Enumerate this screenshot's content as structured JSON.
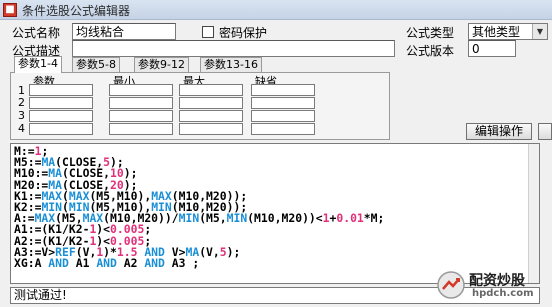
{
  "window": {
    "title": "条件选股公式编辑器"
  },
  "form": {
    "name_label": "公式名称",
    "name_value": "均线粘合",
    "password_label": "密码保护",
    "desc_label": "公式描述",
    "desc_value": "",
    "type_label": "公式类型",
    "type_value": "其他类型",
    "version_label": "公式版本",
    "version_value": "0"
  },
  "tabs": [
    "参数1-4",
    "参数5-8",
    "参数9-12",
    "参数13-16"
  ],
  "params": {
    "headers": [
      "参数",
      "最小",
      "最大",
      "缺省"
    ],
    "row_numbers": [
      "1",
      "2",
      "3",
      "4"
    ]
  },
  "buttons": {
    "edit_op": "编辑操作"
  },
  "code": [
    [
      [
        "M:=",
        "p"
      ],
      [
        "1",
        "n"
      ],
      [
        ";",
        "p"
      ]
    ],
    [
      [
        "M5:=",
        "p"
      ],
      [
        "MA",
        "f"
      ],
      [
        "(CLOSE,",
        "p"
      ],
      [
        "5",
        "n"
      ],
      [
        ");",
        "p"
      ]
    ],
    [
      [
        "M10:=",
        "p"
      ],
      [
        "MA",
        "f"
      ],
      [
        "(CLOSE,",
        "p"
      ],
      [
        "10",
        "n"
      ],
      [
        ");",
        "p"
      ]
    ],
    [
      [
        "M20:=",
        "p"
      ],
      [
        "MA",
        "f"
      ],
      [
        "(CLOSE,",
        "p"
      ],
      [
        "20",
        "n"
      ],
      [
        ");",
        "p"
      ]
    ],
    [
      [
        "K1:=",
        "p"
      ],
      [
        "MAX",
        "f"
      ],
      [
        "(",
        "p"
      ],
      [
        "MAX",
        "f"
      ],
      [
        "(M5,M10),",
        "p"
      ],
      [
        "MAX",
        "f"
      ],
      [
        "(M10,M20));",
        "p"
      ]
    ],
    [
      [
        "K2:=",
        "p"
      ],
      [
        "MIN",
        "f"
      ],
      [
        "(",
        "p"
      ],
      [
        "MIN",
        "f"
      ],
      [
        "(M5,M10),",
        "p"
      ],
      [
        "MIN",
        "f"
      ],
      [
        "(M10,M20));",
        "p"
      ]
    ],
    [
      [
        "A:=",
        "p"
      ],
      [
        "MAX",
        "f"
      ],
      [
        "(M5,",
        "p"
      ],
      [
        "MAX",
        "f"
      ],
      [
        "(M10,M20))/",
        "p"
      ],
      [
        "MIN",
        "f"
      ],
      [
        "(M5,",
        "p"
      ],
      [
        "MIN",
        "f"
      ],
      [
        "(M10,M20))<",
        "p"
      ],
      [
        "1",
        "n"
      ],
      [
        "+",
        "p"
      ],
      [
        "0.01",
        "n"
      ],
      [
        "*M;",
        "p"
      ]
    ],
    [
      [
        "A1:=(K1/K2-",
        "p"
      ],
      [
        "1",
        "n"
      ],
      [
        ")<",
        "p"
      ],
      [
        "0.005",
        "n"
      ],
      [
        ";",
        "p"
      ]
    ],
    [
      [
        "A2:=(K1/K2-",
        "p"
      ],
      [
        "1",
        "n"
      ],
      [
        ")<",
        "p"
      ],
      [
        "0.005",
        "n"
      ],
      [
        ";",
        "p"
      ]
    ],
    [
      [
        "A3:=V>",
        "p"
      ],
      [
        "REF",
        "f"
      ],
      [
        "(V,",
        "p"
      ],
      [
        "1",
        "n"
      ],
      [
        ")*",
        "p"
      ],
      [
        "1.5",
        "n"
      ],
      [
        " ",
        "p"
      ],
      [
        "AND",
        "f"
      ],
      [
        " V>",
        "p"
      ],
      [
        "MA",
        "f"
      ],
      [
        "(V,",
        "p"
      ],
      [
        "5",
        "n"
      ],
      [
        ");",
        "p"
      ]
    ],
    [
      [
        "XG:A ",
        "p"
      ],
      [
        "AND",
        "f"
      ],
      [
        " A1 ",
        "p"
      ],
      [
        "AND",
        "f"
      ],
      [
        " A2 ",
        "p"
      ],
      [
        "AND",
        "f"
      ],
      [
        " A3 ;",
        "p"
      ]
    ]
  ],
  "status": {
    "message": "测试通过!"
  },
  "watermark": {
    "brand": "配资炒股",
    "site": "hpdch.com"
  },
  "colors": {
    "keyword": "#1a8fd6",
    "number": "#e0307a",
    "plain": "#000000"
  }
}
